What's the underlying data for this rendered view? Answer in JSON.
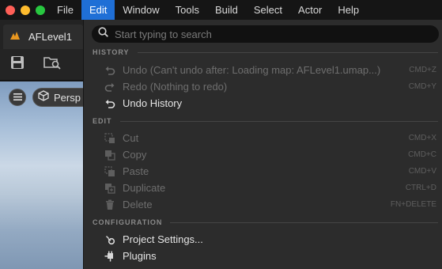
{
  "menubar": {
    "items": [
      "File",
      "Edit",
      "Window",
      "Tools",
      "Build",
      "Select",
      "Actor",
      "Help"
    ],
    "active": "Edit"
  },
  "editor": {
    "level_tab": "AFLevel1",
    "viewport_mode": "Persp"
  },
  "dropdown": {
    "search_placeholder": "Start typing to search",
    "sections": {
      "history": "HISTORY",
      "edit": "EDIT",
      "configuration": "CONFIGURATION"
    },
    "history_items": [
      {
        "label": "Undo (Can't undo after: Loading map: AFLevel1.umap...)",
        "shortcut": "CMD+Z",
        "enabled": false,
        "icon": "undo-icon"
      },
      {
        "label": "Redo (Nothing to redo)",
        "shortcut": "CMD+Y",
        "enabled": false,
        "icon": "redo-icon"
      },
      {
        "label": "Undo History",
        "shortcut": "",
        "enabled": true,
        "icon": "undo-history-icon"
      }
    ],
    "edit_items": [
      {
        "label": "Cut",
        "shortcut": "CMD+X",
        "enabled": false,
        "icon": "cut-icon"
      },
      {
        "label": "Copy",
        "shortcut": "CMD+C",
        "enabled": false,
        "icon": "copy-icon"
      },
      {
        "label": "Paste",
        "shortcut": "CMD+V",
        "enabled": false,
        "icon": "paste-icon"
      },
      {
        "label": "Duplicate",
        "shortcut": "CTRL+D",
        "enabled": false,
        "icon": "duplicate-icon"
      },
      {
        "label": "Delete",
        "shortcut": "FN+DELETE",
        "enabled": false,
        "icon": "delete-icon"
      }
    ],
    "configuration_items": [
      {
        "label": "Project Settings...",
        "shortcut": "",
        "enabled": true,
        "icon": "project-settings-icon"
      },
      {
        "label": "Plugins",
        "shortcut": "",
        "enabled": true,
        "icon": "plugins-icon"
      }
    ]
  },
  "colors": {
    "menubar_bg": "#151515",
    "active_menu": "#1f6fd6",
    "dropdown_bg": "#2c2c2c",
    "enabled_text": "#e4e4e4",
    "disabled_text": "#6e6e6e"
  }
}
